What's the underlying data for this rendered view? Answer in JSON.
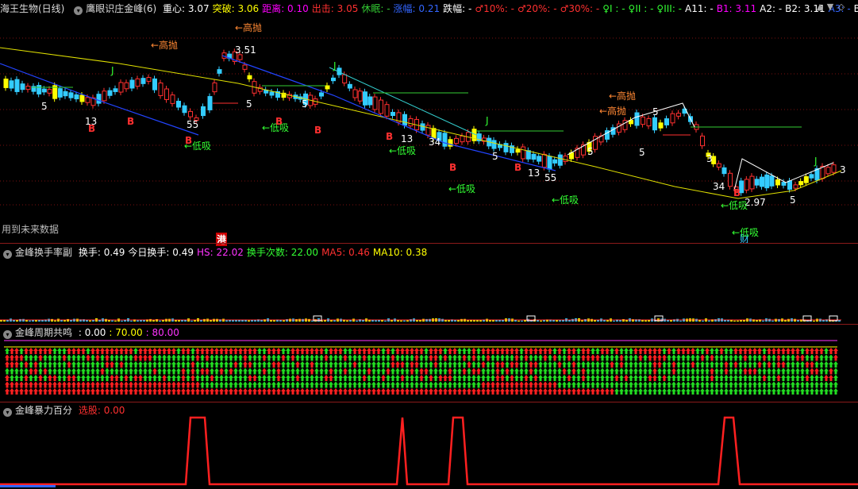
{
  "header": {
    "stock_name": "海王生物(日线)",
    "indicator": "鹰眼识庄金峰(6)",
    "items": [
      {
        "label": "重心:",
        "value": "3.07",
        "color": "#ffffff"
      },
      {
        "label": "突破:",
        "value": "3.06",
        "color": "#ffff00"
      },
      {
        "label": "距离:",
        "value": "0.10",
        "color": "#ff00ff"
      },
      {
        "label": "出击:",
        "value": "3.05",
        "color": "#ff3030"
      },
      {
        "label": "休眠:",
        "value": "-",
        "color": "#33cc33"
      },
      {
        "label": "涨幅:",
        "value": "0.21",
        "color": "#3366ff"
      },
      {
        "label": "跌幅:",
        "value": "-",
        "color": "#ffffff"
      },
      {
        "label": "♂10%:",
        "value": "-",
        "color": "#ff3030"
      },
      {
        "label": "♂20%:",
        "value": "-",
        "color": "#ff3030"
      },
      {
        "label": "♂30%:",
        "value": "-",
        "color": "#ff3030"
      },
      {
        "label": "♀I :",
        "value": "-",
        "color": "#33ff33"
      },
      {
        "label": "♀II :",
        "value": "-",
        "color": "#33ff33"
      },
      {
        "label": "♀III:",
        "value": "-",
        "color": "#33ff33"
      },
      {
        "label": "A11:",
        "value": "-",
        "color": "#ffffff"
      },
      {
        "label": "B1:",
        "value": "3.11",
        "color": "#ff00ff"
      },
      {
        "label": "A2:",
        "value": "-",
        "color": "#ffffff"
      },
      {
        "label": "B2:",
        "value": "3.11",
        "color": "#ffffff"
      },
      {
        "label": "A3:",
        "value": "-",
        "color": "#3366ff"
      },
      {
        "label": "B3:",
        "value": "-",
        "color": "#ffffff"
      }
    ],
    "ctrl_up": "▲",
    "ctrl_down": "▼",
    "ctrl_diamond": "◇"
  },
  "main_chart": {
    "future_data_note": "用到未来数据",
    "sell_label": "←高抛",
    "buy_label": "←低吸",
    "b_marker": "B",
    "special_marker": "港",
    "cai_marker": "财",
    "price_labels": [
      "3.51",
      "2.97"
    ],
    "count_labels": [
      "5",
      "13",
      "34",
      "3",
      "J",
      "55"
    ],
    "colors": {
      "up": "#ff3030",
      "down": "#33ccff",
      "ma_yellow": "#e0e000",
      "blue_line": "#2244ff",
      "cyan_line": "#33cccc",
      "green_line": "#33cc33",
      "white_line": "#ffffff"
    }
  },
  "turnover_panel": {
    "title": "金峰换手率副",
    "items": [
      {
        "label": "换手:",
        "value": "0.49",
        "color": "#ffffff"
      },
      {
        "label": "今日换手:",
        "value": "0.49",
        "color": "#ffffff"
      },
      {
        "label": "HS:",
        "value": "22.02",
        "color": "#ff33ff"
      },
      {
        "label": "换手次数:",
        "value": "22.00",
        "color": "#33ff33"
      },
      {
        "label": "MA5:",
        "value": "0.46",
        "color": "#ff3030"
      },
      {
        "label": "MA10:",
        "value": "0.38",
        "color": "#ffff00"
      }
    ]
  },
  "cycle_panel": {
    "title": "金峰周期共鸣",
    "values": [
      {
        "value": ": 0.00",
        "color": "#ffffff"
      },
      {
        "value": ": 70.00",
        "color": "#ffff00"
      },
      {
        "value": ": 80.00",
        "color": "#ff33ff"
      }
    ]
  },
  "burst_panel": {
    "title": "金峰暴力百分",
    "items": [
      {
        "label": "选股:",
        "value": "0.00",
        "color": "#ff3030"
      }
    ]
  }
}
